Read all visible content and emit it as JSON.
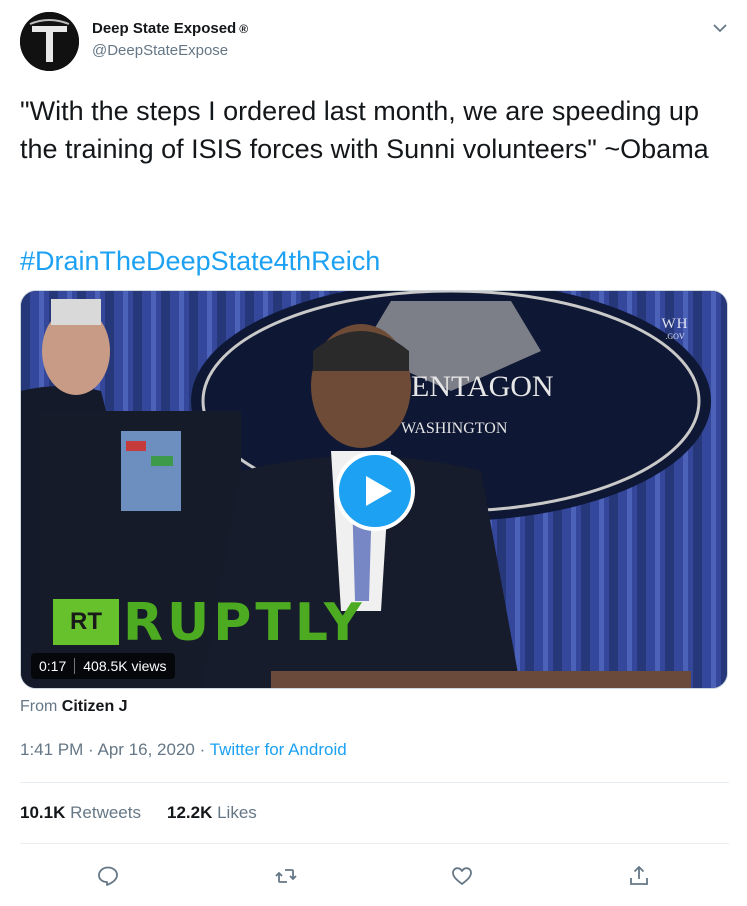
{
  "user": {
    "display_name": "Deep State Exposed",
    "registered_mark": "®",
    "handle": "@DeepStateExpose"
  },
  "tweet": {
    "text": "\"With the steps I ordered last month, we are speeding up the training of ISIS forces with Sunni volunteers\" ~Obama",
    "hashtag": "#DrainTheDeepState4thReich"
  },
  "video": {
    "duration": "0:17",
    "views": "408.5K views",
    "backdrop_text_1": "ENTAGON",
    "backdrop_text_2": "WASHINGTON",
    "watermark_1": "WH",
    "watermark_2": ".GOV",
    "rt_label": "RT",
    "ruptly_label": "RUPTLY"
  },
  "attribution": {
    "prefix": "From",
    "source_name": "Citizen J"
  },
  "meta": {
    "time": "1:41 PM",
    "separator_1": "·",
    "date": "Apr 16, 2020",
    "separator_2": "·",
    "client": "Twitter for Android"
  },
  "stats": {
    "retweets_count": "10.1K",
    "retweets_label": "Retweets",
    "likes_count": "12.2K",
    "likes_label": "Likes"
  },
  "colors": {
    "accent": "#1da1f2",
    "secondary_text": "#657786",
    "primary_text": "#14171a",
    "divider": "#e6ecf0"
  },
  "icons": {
    "caret": "chevron-down-icon",
    "reply": "reply-icon",
    "retweet": "retweet-icon",
    "like": "heart-icon",
    "share": "share-icon",
    "play": "play-icon"
  }
}
